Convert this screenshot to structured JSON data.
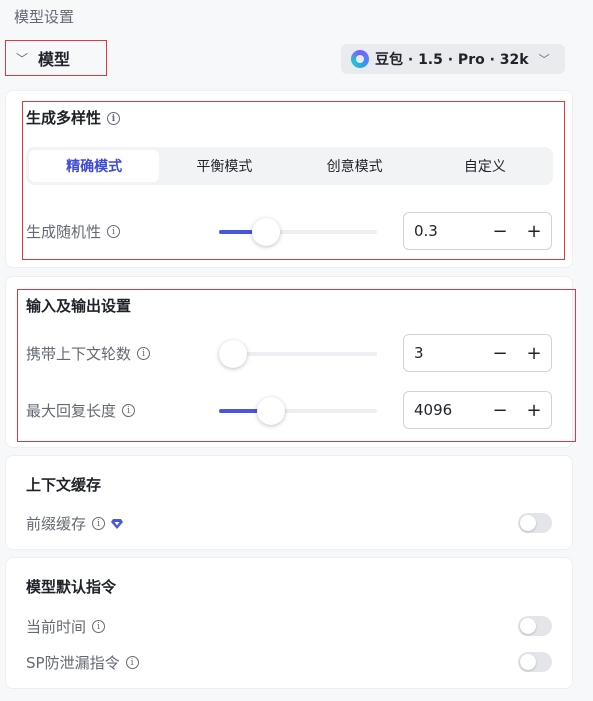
{
  "header": {
    "title": "模型设置"
  },
  "model": {
    "toggle_label": "模型",
    "selected": "豆包 · 1.5 · Pro · 32k"
  },
  "diversity": {
    "title": "生成多样性",
    "tabs": [
      {
        "label": "精确模式",
        "active": true
      },
      {
        "label": "平衡模式",
        "active": false
      },
      {
        "label": "创意模式",
        "active": false
      },
      {
        "label": "自定义",
        "active": false
      }
    ],
    "randomness": {
      "label": "生成随机性",
      "value": "0.3",
      "slider_fraction": 0.3
    }
  },
  "io": {
    "title": "输入及输出设置",
    "context_rounds": {
      "label": "携带上下文轮数",
      "value": "3",
      "slider_fraction": 0.03
    },
    "max_reply": {
      "label": "最大回复长度",
      "value": "4096",
      "slider_fraction": 0.33
    }
  },
  "cache": {
    "title": "上下文缓存",
    "prefix_cache": {
      "label": "前缀缓存",
      "enabled": false
    }
  },
  "default_prompt": {
    "title": "模型默认指令",
    "current_time": {
      "label": "当前时间",
      "enabled": false
    },
    "sp_leak": {
      "label": "SP防泄漏指令",
      "enabled": false
    }
  },
  "stepper": {
    "minus": "−",
    "plus": "+"
  },
  "colors": {
    "accent": "#4a55e0",
    "highlight_border": "#e0383e"
  }
}
